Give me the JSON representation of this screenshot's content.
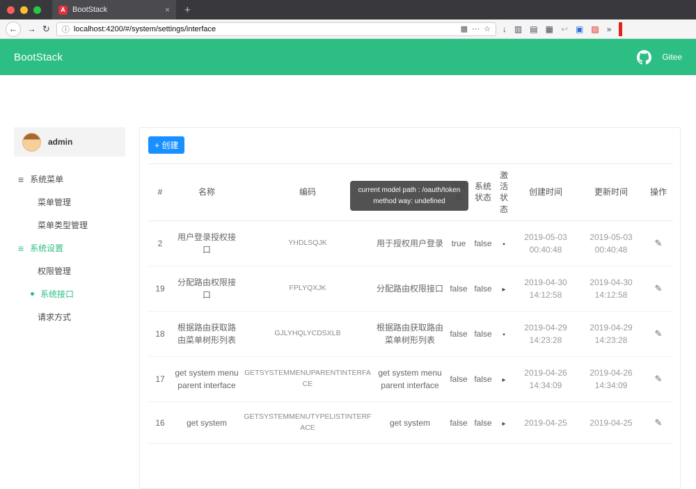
{
  "colors": {
    "accent": "#2dbe83",
    "primary_blue": "#1890ff"
  },
  "browser": {
    "tab_title": "BootStack",
    "favicon_letter": "A",
    "url": "localhost:4200/#/system/settings/interface",
    "icons": {
      "close": "×",
      "new_tab": "+",
      "back": "←",
      "forward": "→",
      "reload": "↻",
      "info": "ⓘ",
      "reader": "▩",
      "overflow": "⋯",
      "bookmark": "☆",
      "download": "↓",
      "library": "▥",
      "sidebar": "▤",
      "highlights": "▦",
      "undo": "↩",
      "screenshot": "▣",
      "pdf": "▨",
      "more": "»"
    }
  },
  "header": {
    "brand": "BootStack",
    "gitee": "Gitee"
  },
  "sidebar": {
    "username": "admin",
    "menu_icon": "≡",
    "items": [
      {
        "label": "系统菜单"
      },
      {
        "label": "菜单管理"
      },
      {
        "label": "菜单类型管理"
      },
      {
        "label": "系统设置"
      },
      {
        "label": "权限管理"
      },
      {
        "label": "系统接口"
      },
      {
        "label": "请求方式"
      }
    ]
  },
  "main": {
    "create_button": "+ 创建",
    "edit_icon": "✎",
    "tooltip": {
      "line1": "current model path : /oauth/token",
      "line2": "method way: undefined"
    },
    "table": {
      "headers": [
        "#",
        "名称",
        "编码",
        "",
        "白名单",
        "系统状态",
        "激活状态",
        "创建时间",
        "更新时间",
        "操作"
      ],
      "rows": [
        {
          "id": "2",
          "name": "用户登录授权接口",
          "code": "YHDLSQJK",
          "desc": "用于授权用户登录",
          "whitelist": "true",
          "system": "false",
          "state_icon": "▪",
          "created": "2019-05-03 00:40:48",
          "updated": "2019-05-03 00:40:48"
        },
        {
          "id": "19",
          "name": "分配路由权限接口",
          "code": "FPLYQXJK",
          "desc": "分配路由权限接口",
          "whitelist": "false",
          "system": "false",
          "state_icon": "▸",
          "created": "2019-04-30 14:12:58",
          "updated": "2019-04-30 14:12:58"
        },
        {
          "id": "18",
          "name": "根据路由获取路由菜单树形列表",
          "code": "GJLYHQLYCDSXLB",
          "desc": "根据路由获取路由菜单树形列表",
          "whitelist": "false",
          "system": "false",
          "state_icon": "▪",
          "created": "2019-04-29 14:23:28",
          "updated": "2019-04-29 14:23:28"
        },
        {
          "id": "17",
          "name": "get system menu parent interface",
          "code": "GETSYSTEMMENUPARENTINTERFACE",
          "desc": "get system menu parent interface",
          "whitelist": "false",
          "system": "false",
          "state_icon": "▸",
          "created": "2019-04-26 14:34:09",
          "updated": "2019-04-26 14:34:09"
        },
        {
          "id": "16",
          "name": "get system",
          "code": "GETSYSTEMMENUTYPELISTINTERFACE",
          "desc": "get system",
          "whitelist": "false",
          "system": "false",
          "state_icon": "▸",
          "created": "2019-04-25",
          "updated": "2019-04-25"
        }
      ]
    }
  }
}
